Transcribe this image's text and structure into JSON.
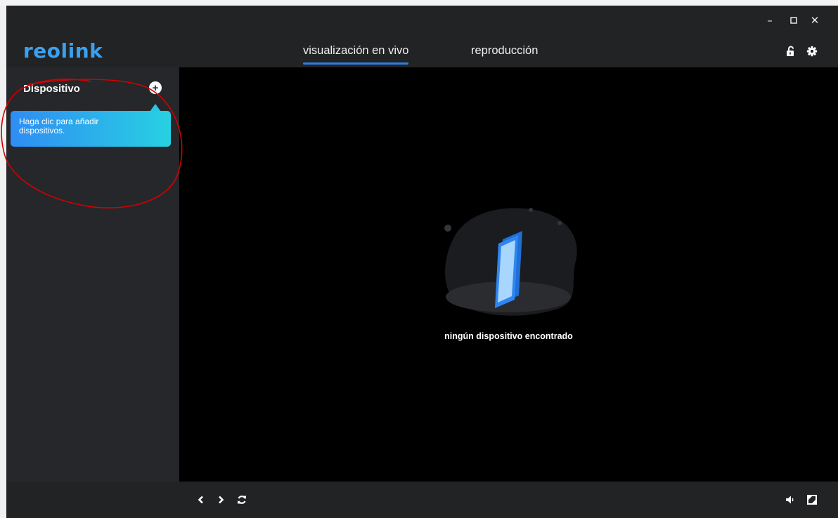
{
  "window": {
    "minimize_icon": "minimize-icon",
    "maximize_icon": "maximize-icon",
    "close_icon": "close-icon"
  },
  "header": {
    "logo": "reolink",
    "tabs": [
      {
        "label": "visualización en vivo",
        "active": true
      },
      {
        "label": "reproducción",
        "active": false
      }
    ],
    "lock_icon": "unlock-icon",
    "settings_icon": "gear-icon"
  },
  "sidebar": {
    "title": "Dispositivo",
    "add_icon": "plus-circle-icon",
    "tooltip": "Haga clic para añadir dispositivos."
  },
  "main": {
    "empty_message": "ningún dispositivo encontrado"
  },
  "bottom": {
    "prev_icon": "chevron-left-icon",
    "next_icon": "chevron-right-icon",
    "refresh_icon": "refresh-icon",
    "volume_icon": "volume-icon",
    "fullscreen_icon": "fullscreen-icon"
  },
  "colors": {
    "accent": "#2e7ee6",
    "brand": "#3aa0f0",
    "annotation": "#d40000"
  }
}
